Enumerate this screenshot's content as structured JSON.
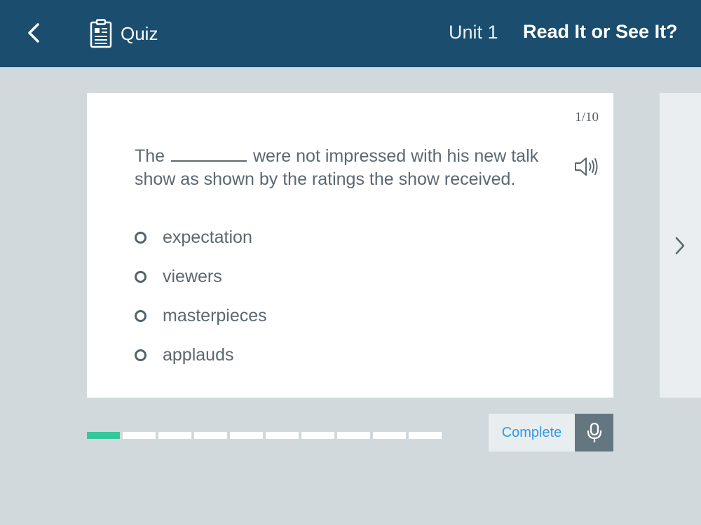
{
  "header": {
    "back_icon": "chevron-left-icon",
    "quiz_icon": "quiz-document-icon",
    "quiz_label": "Quiz",
    "unit_label": "Unit 1",
    "lesson_title": "Read It or See It?",
    "background_color": "#1a4d6e"
  },
  "card": {
    "counter": "1/10",
    "question_before": "The",
    "question_after": "were not impressed with his new talk show as shown by the ratings the show received.",
    "speaker_icon": "speaker-icon",
    "options": [
      {
        "label": "expectation"
      },
      {
        "label": "viewers"
      },
      {
        "label": "masterpieces"
      },
      {
        "label": "applauds"
      }
    ]
  },
  "next_icon": "chevron-right-icon",
  "progress": {
    "current": 1,
    "total": 10,
    "active_color": "#35c79b"
  },
  "footer": {
    "complete_label": "Complete",
    "mic_icon": "microphone-icon"
  }
}
